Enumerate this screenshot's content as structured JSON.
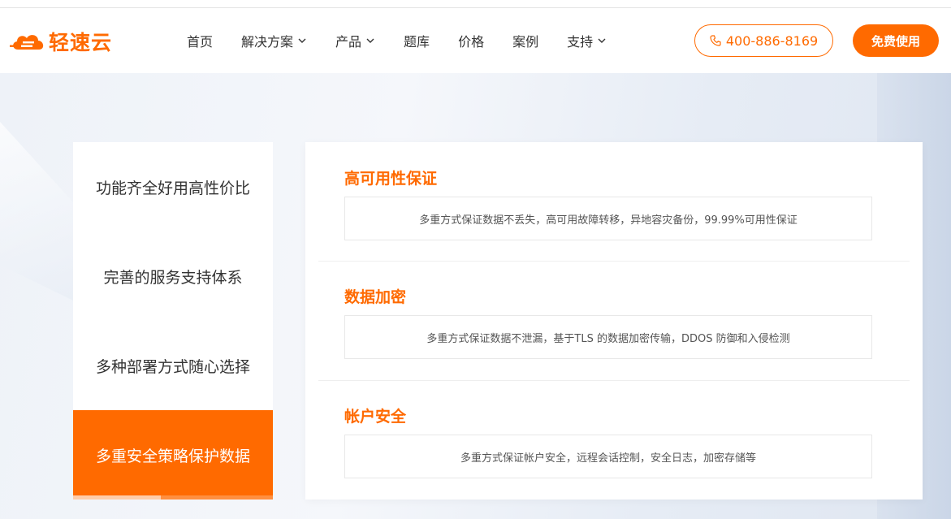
{
  "logo": {
    "text": "轻速云"
  },
  "nav": {
    "items": [
      {
        "label": "首页",
        "dropdown": false
      },
      {
        "label": "解决方案",
        "dropdown": true
      },
      {
        "label": "产品",
        "dropdown": true
      },
      {
        "label": "题库",
        "dropdown": false
      },
      {
        "label": "价格",
        "dropdown": false
      },
      {
        "label": "案例",
        "dropdown": false
      },
      {
        "label": "支持",
        "dropdown": true
      }
    ]
  },
  "header": {
    "phone": "400-886-8169",
    "cta": "免费使用"
  },
  "sidebar": {
    "items": [
      {
        "label": "功能齐全好用高性价比",
        "active": false
      },
      {
        "label": "完善的服务支持体系",
        "active": false
      },
      {
        "label": "多种部署方式随心选择",
        "active": false
      },
      {
        "label": "多重安全策略保护数据",
        "active": true
      }
    ],
    "active_progress": 0.44
  },
  "features": [
    {
      "title": "高可用性保证",
      "desc": "多重方式保证数据不丢失，高可用故障转移，异地容灾备份，99.99%可用性保证"
    },
    {
      "title": "数据加密",
      "desc": "多重方式保证数据不泄漏，基于TLS 的数据加密传输，DDOS 防御和入侵检测"
    },
    {
      "title": "帐户安全",
      "desc": "多重方式保证帐户安全，远程会话控制，安全日志，加密存储等"
    }
  ],
  "colors": {
    "accent": "#ff6a00"
  }
}
